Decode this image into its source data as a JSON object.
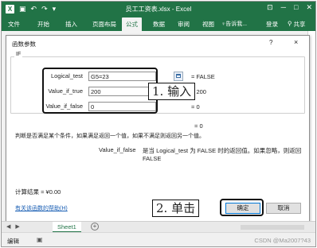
{
  "app": {
    "window_title": "员工工资表.xlsx - Excel",
    "icon_letter": "X"
  },
  "ribbon": {
    "tabs": [
      "文件",
      "开始",
      "插入",
      "页面布局",
      "公式",
      "数据",
      "审阅",
      "视图"
    ],
    "active_tab": "公式",
    "tell_me": "♀告诉我...",
    "login": "登录",
    "share": "共享"
  },
  "dialog": {
    "title": "函数参数",
    "help": "?",
    "close": "×",
    "function_name": "IF",
    "args": [
      {
        "label": "Logical_test",
        "value": "G5=23",
        "result": "=  FALSE"
      },
      {
        "label": "Value_if_true",
        "value": "200",
        "result": "=  200"
      },
      {
        "label": "Value_if_false",
        "value": "0",
        "result": "=  0"
      }
    ],
    "final_result": "=  0",
    "description": "判断是否满足某个条件，如果满足返回一个值，如果不满足则返回另一个值。",
    "arg_desc_name": "Value_if_false",
    "arg_desc_text": "是当 Logical_test 为 FALSE 时的返回值。如果忽略，则返回 FALSE",
    "calc_result": "计算结果 =  ¥0.00",
    "help_link": "有关该函数的帮助(H)",
    "ok_label": "确定",
    "cancel_label": "取消"
  },
  "callouts": {
    "step1": "1. 输入",
    "step2": "2. 单击"
  },
  "sheet": {
    "tab": "Sheet1",
    "add": "+"
  },
  "status": {
    "mode": "编辑",
    "watermark": "CSDN @Ma2007?43"
  },
  "colors": {
    "excel_green": "#217346",
    "link_blue": "#1a5fb4",
    "ok_border": "#0078d7"
  }
}
